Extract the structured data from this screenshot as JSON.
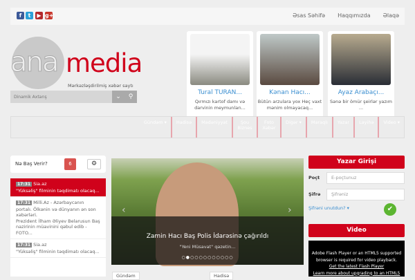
{
  "topbar": {
    "social": [
      "facebook",
      "twitter",
      "youtube",
      "google-plus"
    ],
    "links": [
      "Əsas Səhifə",
      "Haqqımızda",
      "Əlaqə"
    ]
  },
  "logo": {
    "ana": "ana",
    "media": "media",
    "tagline": "Mərkəzləşdirilmiş xəbər saytı"
  },
  "search": {
    "placeholder": "Dinamik Axtarış"
  },
  "authors": [
    {
      "name": "Tural TURAN...",
      "text": "Qırmızı kartof damı və darvinin meymunları..."
    },
    {
      "name": "Kənan Hacı...",
      "text": "Bütün arzulara yox Heç vaxt mənim olmayacaq..."
    },
    {
      "name": "Ayaz Arabaçı...",
      "text": "Sənə bir ömür şeirlər yazım ..."
    }
  ],
  "nav": [
    "Gündəm ▾",
    "Hadisə",
    "Mədəniyyət",
    "Şou Biznes",
    "Foto Xəbər",
    "Digər ▾",
    "Maraqlı",
    "Yazar",
    "Layihə",
    "Video ▾"
  ],
  "whats_up": {
    "title": "Nə Baş Verir?",
    "count": "6"
  },
  "news": [
    {
      "time": "17:31",
      "source": "Sia.az",
      "text": "\"Yüksəliş\" filminin təqdimatı olacaq..."
    },
    {
      "time": "17:31",
      "source": "Milli.Az - Azərbaycanın portalı. Ölkənin və dünyanın ən son xəbərləri.",
      "text": "Prezident İlham Əliyev Belarusun Baş nazirinin müavinini qəbul edib - FOTO..."
    },
    {
      "time": "17:31",
      "source": "Sia.az",
      "text": "\"Yüksəliş\" filminin təqdimatı olacaq..."
    }
  ],
  "slider": {
    "title": "Zamin Hacı Baş Polis İdarəsinə çağırıldı",
    "subtitle": "\"Yeni Müsavat\" qəzetin...",
    "slides": 12,
    "active": 1
  },
  "tags": [
    "Gündəm",
    "Hadisə"
  ],
  "login": {
    "title": "Yazar Girişi",
    "email_label": "Poçt",
    "email_placeholder": "E-poçtunuz",
    "pass_label": "Şifrə",
    "pass_placeholder": "Şifrəniz",
    "forgot": "Şifrəni unutdun? ▾"
  },
  "video": {
    "title": "Video",
    "line1": "Adobe Flash Player or an HTML5 supported browser is required for video playback.",
    "link1": "Get the latest Flash Player",
    "link2": "Learn more about upgrading to an HTML5"
  }
}
